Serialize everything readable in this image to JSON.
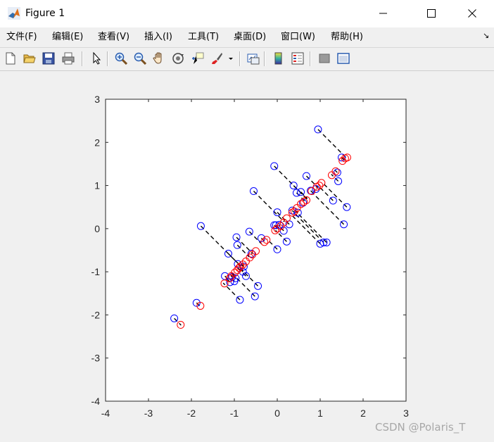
{
  "window": {
    "title": "Figure 1",
    "controls": [
      "minimize",
      "maximize",
      "close"
    ]
  },
  "menu": {
    "items": [
      "文件(F)",
      "编辑(E)",
      "查看(V)",
      "插入(I)",
      "工具(T)",
      "桌面(D)",
      "窗口(W)",
      "帮助(H)"
    ]
  },
  "toolbar": {
    "icons": [
      "new-figure-icon",
      "open-file-icon",
      "save-icon",
      "print-icon",
      "select-arrow-icon",
      "zoom-in-icon",
      "zoom-out-icon",
      "pan-hand-icon",
      "rotate-3d-icon",
      "data-cursor-icon",
      "brush-icon",
      "brush-dropdown-icon",
      "link-plot-icon",
      "insert-colorbar-icon",
      "insert-legend-icon",
      "hide-plot-tools-icon",
      "show-plot-tools-icon"
    ]
  },
  "watermark": "CSDN @Polaris_T",
  "colors": {
    "original_points": "#0000ff",
    "projected_points": "#ff0000",
    "projection_lines": "#000000"
  },
  "chart_data": {
    "type": "scatter",
    "xlim": [
      -4,
      3
    ],
    "ylim": [
      -4,
      3
    ],
    "xticks": [
      "-4",
      "-3",
      "-2",
      "-1",
      "0",
      "1",
      "2",
      "3"
    ],
    "yticks": [
      "3",
      "2",
      "1",
      "0",
      "-1",
      "-2",
      "-3",
      "-4"
    ],
    "grid": false,
    "legend": "none",
    "series": [
      {
        "marker": "circle",
        "color": "blue",
        "points": [
          [
            -2.4,
            -2.08
          ],
          [
            -1.88,
            -1.72
          ],
          [
            -1.78,
            0.06
          ],
          [
            -1.22,
            -1.1
          ],
          [
            -1.14,
            -0.58
          ],
          [
            -1.1,
            -1.24
          ],
          [
            -1.05,
            -1.12
          ],
          [
            -1.0,
            -1.22
          ],
          [
            -0.97,
            -1.15
          ],
          [
            -0.95,
            -0.2
          ],
          [
            -0.93,
            -0.38
          ],
          [
            -0.92,
            -0.82
          ],
          [
            -0.87,
            -1.65
          ],
          [
            -0.8,
            -1.0
          ],
          [
            -0.78,
            -0.88
          ],
          [
            -0.73,
            -1.1
          ],
          [
            -0.65,
            -0.07
          ],
          [
            -0.6,
            -0.58
          ],
          [
            -0.55,
            0.87
          ],
          [
            -0.52,
            -1.57
          ],
          [
            -0.45,
            -1.33
          ],
          [
            -0.37,
            -0.22
          ],
          [
            -0.07,
            1.45
          ],
          [
            -0.07,
            0.08
          ],
          [
            -0.03,
            0.08
          ],
          [
            0.0,
            -0.48
          ],
          [
            0.0,
            0.38
          ],
          [
            0.05,
            0.09
          ],
          [
            0.15,
            -0.05
          ],
          [
            0.22,
            -0.3
          ],
          [
            0.28,
            0.1
          ],
          [
            0.35,
            0.42
          ],
          [
            0.38,
            1.0
          ],
          [
            0.45,
            0.83
          ],
          [
            0.48,
            0.37
          ],
          [
            0.55,
            0.85
          ],
          [
            0.6,
            0.6
          ],
          [
            0.68,
            1.22
          ],
          [
            0.78,
            0.88
          ],
          [
            0.9,
            0.92
          ],
          [
            0.95,
            2.3
          ],
          [
            1.0,
            -0.35
          ],
          [
            1.08,
            -0.32
          ],
          [
            1.15,
            -0.32
          ],
          [
            1.3,
            0.65
          ],
          [
            1.4,
            1.3
          ],
          [
            1.42,
            1.1
          ],
          [
            1.5,
            1.65
          ],
          [
            1.55,
            0.1
          ],
          [
            1.62,
            0.5
          ]
        ]
      },
      {
        "marker": "circle",
        "color": "red",
        "points": [
          [
            -2.25,
            -2.23
          ],
          [
            -1.79,
            -1.79
          ],
          [
            -1.23,
            -1.27
          ],
          [
            -1.11,
            -1.15
          ],
          [
            -1.07,
            -1.1
          ],
          [
            -0.99,
            -1.02
          ],
          [
            -0.93,
            -0.96
          ],
          [
            -0.89,
            -0.91
          ],
          [
            -0.86,
            -0.88
          ],
          [
            -0.8,
            -0.83
          ],
          [
            -0.73,
            -0.76
          ],
          [
            -0.64,
            -0.67
          ],
          [
            -0.58,
            -0.6
          ],
          [
            -0.5,
            -0.52
          ],
          [
            -0.3,
            -0.31
          ],
          [
            -0.25,
            -0.26
          ],
          [
            -0.05,
            -0.04
          ],
          [
            0.0,
            0.0
          ],
          [
            0.08,
            0.06
          ],
          [
            0.15,
            0.14
          ],
          [
            0.22,
            0.24
          ],
          [
            0.35,
            0.37
          ],
          [
            0.4,
            0.4
          ],
          [
            0.46,
            0.48
          ],
          [
            0.55,
            0.57
          ],
          [
            0.62,
            0.62
          ],
          [
            0.68,
            0.66
          ],
          [
            0.8,
            0.87
          ],
          [
            0.92,
            0.97
          ],
          [
            0.98,
            1.0
          ],
          [
            1.03,
            1.06
          ],
          [
            1.27,
            1.24
          ],
          [
            1.36,
            1.33
          ],
          [
            1.52,
            1.57
          ],
          [
            1.58,
            1.63
          ],
          [
            1.63,
            1.65
          ]
        ]
      }
    ]
  }
}
